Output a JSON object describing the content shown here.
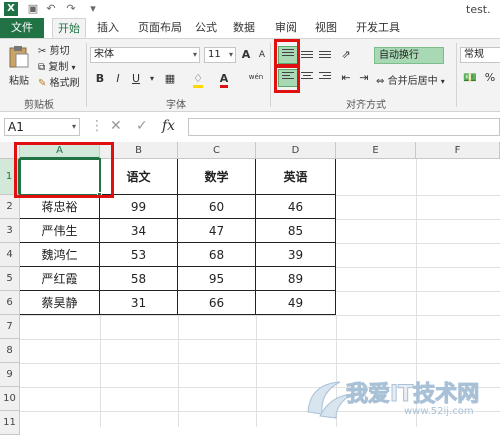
{
  "titlebar": {
    "filename": "test."
  },
  "ribbon_tabs": [
    "文件",
    "开始",
    "插入",
    "页面布局",
    "公式",
    "数据",
    "审阅",
    "视图",
    "开发工具"
  ],
  "clipboard": {
    "paste": "粘贴",
    "cut": "剪切",
    "copy": "复制",
    "format_painter": "格式刷",
    "group": "剪贴板"
  },
  "font": {
    "name": "宋体",
    "size": "11",
    "grow": "A",
    "shrink": "A",
    "bold": "B",
    "italic": "I",
    "underline": "U",
    "group": "字体",
    "phonetic": "wén"
  },
  "alignment": {
    "wrap_text": "自动换行",
    "merge_center": "合并后居中",
    "group": "对齐方式"
  },
  "number": {
    "format": "常规"
  },
  "formula_bar": {
    "name_box": "A1",
    "cancel": "✕",
    "enter": "✓",
    "fx": "fx",
    "value": ""
  },
  "columns": [
    "A",
    "B",
    "C",
    "D",
    "E",
    "F"
  ],
  "rows": [
    "1",
    "2",
    "3",
    "4",
    "5",
    "6",
    "7",
    "8",
    "9",
    "10",
    "11"
  ],
  "table": {
    "headers": [
      "",
      "语文",
      "数学",
      "英语"
    ],
    "rows": [
      [
        "蒋忠裕",
        "99",
        "60",
        "46"
      ],
      [
        "严伟生",
        "34",
        "47",
        "85"
      ],
      [
        "魏鸿仁",
        "53",
        "68",
        "39"
      ],
      [
        "严红霞",
        "58",
        "95",
        "89"
      ],
      [
        "蔡昊静",
        "31",
        "66",
        "49"
      ]
    ]
  },
  "watermark": {
    "text": "我爱IT技术网",
    "url": "www.52ij.com"
  },
  "colors": {
    "excel_green": "#217346",
    "highlight_red": "#e01010",
    "selected_align": "#a8d8b4"
  }
}
